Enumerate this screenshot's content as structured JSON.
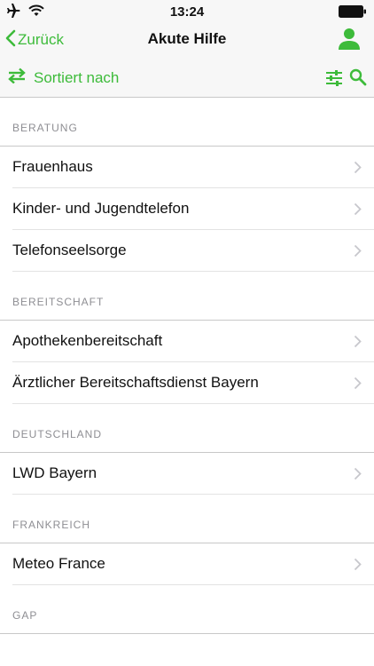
{
  "status_bar": {
    "time": "13:24",
    "icons": [
      "airplane-icon",
      "wifi-icon",
      "battery-icon"
    ]
  },
  "nav": {
    "back_label": "Zurück",
    "title": "Akute Hilfe",
    "right_icon": "user-icon"
  },
  "toolbar": {
    "sort_label": "Sortiert nach",
    "icons": [
      "swap-icon",
      "filter-sliders-icon",
      "search-icon"
    ]
  },
  "colors": {
    "accent": "#3dbb3a",
    "bar_bg": "#f7f7f7",
    "section_text": "#8e8e93",
    "separator": "#c8c8c8"
  },
  "sections": [
    {
      "title": "BERATUNG",
      "items": [
        "Frauenhaus",
        "Kinder- und Jugendtelefon",
        "Telefonseelsorge"
      ]
    },
    {
      "title": "BEREITSCHAFT",
      "items": [
        "Apothekenbereitschaft",
        "Ärztlicher Bereitschaftsdienst Bayern"
      ]
    },
    {
      "title": "DEUTSCHLAND",
      "items": [
        "LWD Bayern"
      ]
    },
    {
      "title": "FRANKREICH",
      "items": [
        "Meteo France"
      ]
    },
    {
      "title": "GAP",
      "items": []
    }
  ]
}
